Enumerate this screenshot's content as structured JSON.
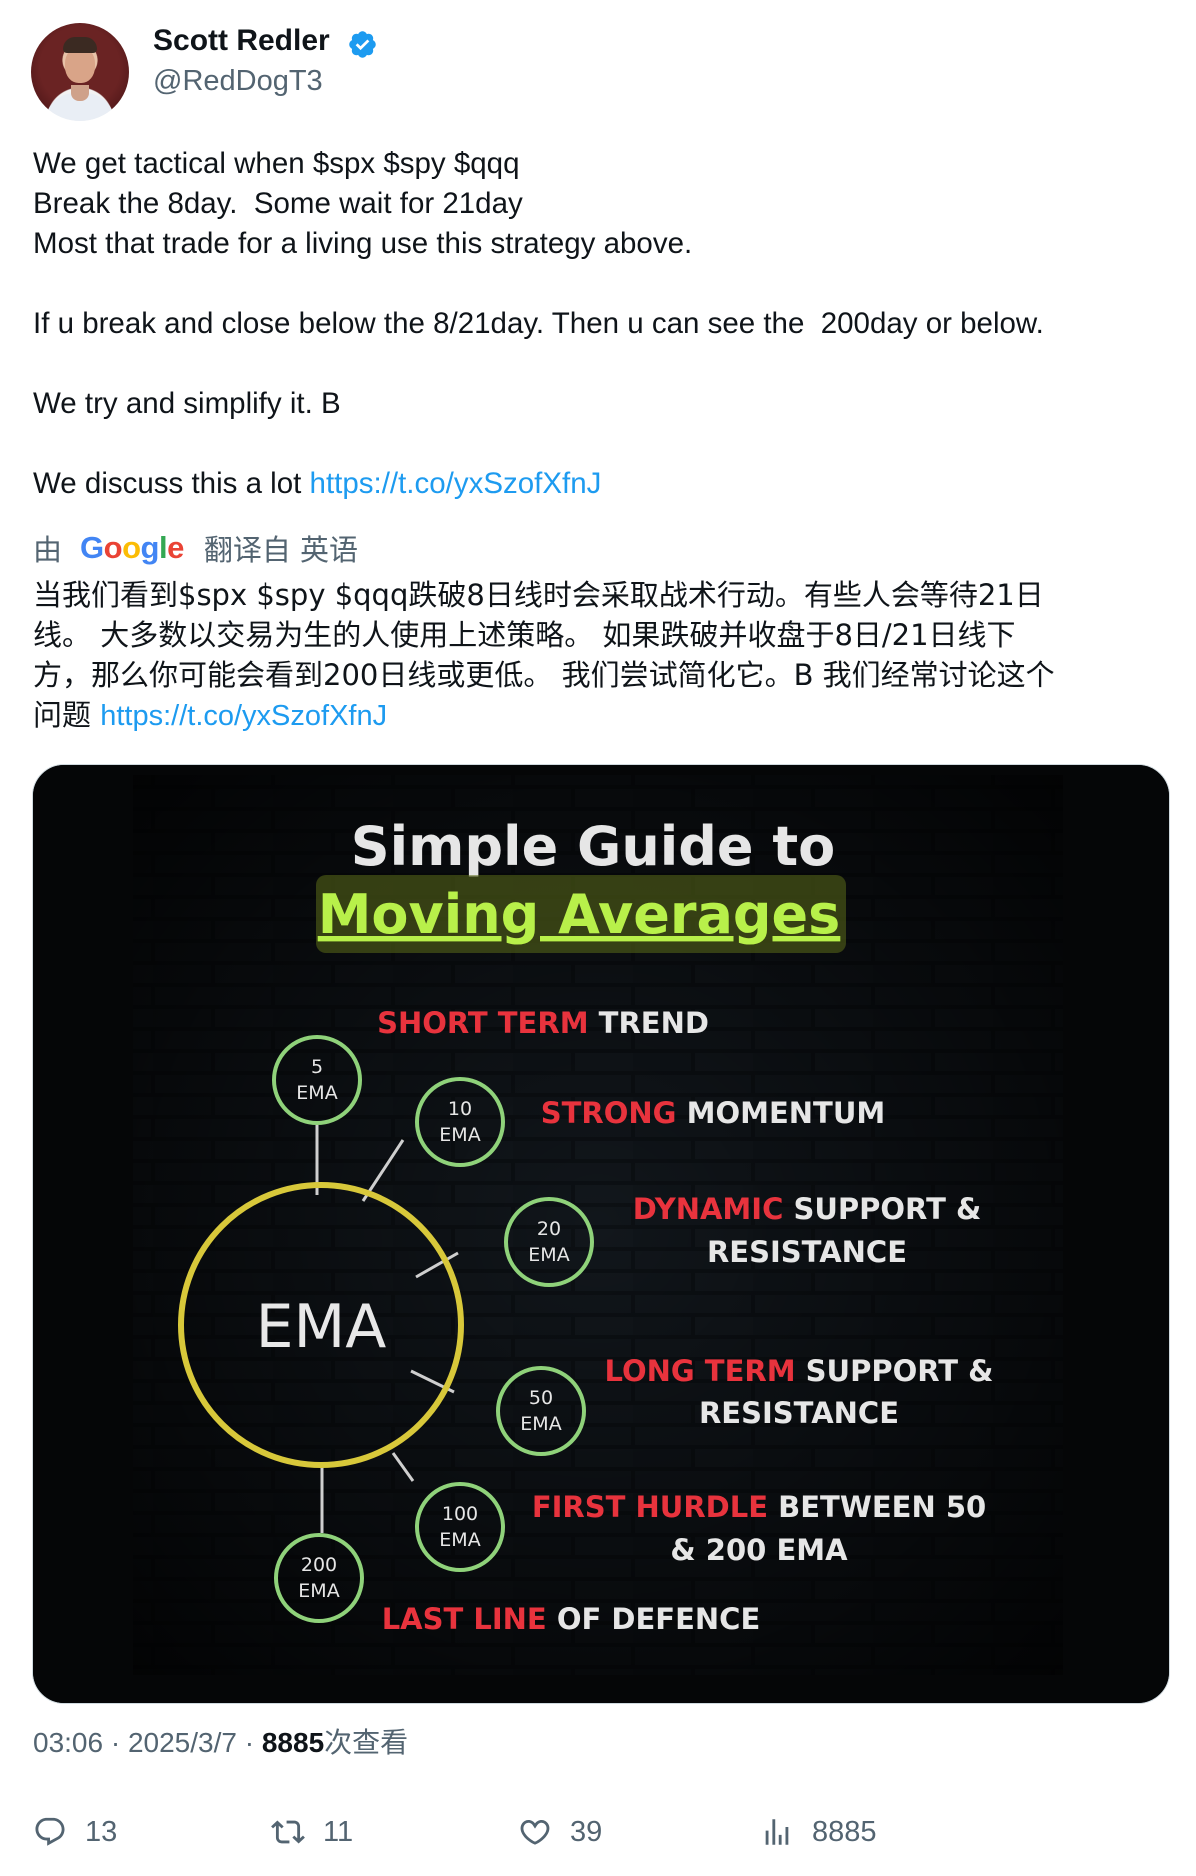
{
  "author": {
    "name": "Scott Redler",
    "handle": "@RedDogT3",
    "verified": true,
    "avatar_icon": "profile-photo"
  },
  "tweet": {
    "lines": [
      "We get tactical when $spx $spy $qqq",
      "Break the 8day.  Some wait for 21day",
      "Most that trade for a living use this strategy above.",
      "",
      "If u break and close below the 8/21day. Then u can see the  200day or below.",
      "",
      "We try and simplify it. B",
      ""
    ],
    "last_line_prefix": "We discuss this a lot ",
    "link": "https://t.co/yxSzofXfnJ"
  },
  "translation": {
    "by": "由",
    "google": [
      "G",
      "o",
      "o",
      "g",
      "l",
      "e"
    ],
    "from": "翻译自 英语",
    "lines": [
      "当我们看到$spx $spy $qqq跌破8日线时会采取战术行动。有些人会等待21日",
      "线。 大多数以交易为生的人使用上述策略。 如果跌破并收盘于8日/21日线下",
      "方，那么你可能会看到200日线或更低。 我们尝试简化它。B 我们经常讨论这个"
    ],
    "last_prefix": "问题 ",
    "link": "https://t.co/yxSzofXfnJ"
  },
  "media": {
    "title_line1": "Simple Guide to",
    "title_line2": "Moving Averages",
    "center_label": "EMA",
    "nodes": [
      {
        "num": "5",
        "unit": "EMA"
      },
      {
        "num": "10",
        "unit": "EMA"
      },
      {
        "num": "20",
        "unit": "EMA"
      },
      {
        "num": "50",
        "unit": "EMA"
      },
      {
        "num": "100",
        "unit": "EMA"
      },
      {
        "num": "200",
        "unit": "EMA"
      }
    ],
    "descriptions": [
      {
        "red": "SHORT TERM",
        "white": " TREND",
        "white2": ""
      },
      {
        "red": "STRONG",
        "white": " MOMENTUM",
        "white2": ""
      },
      {
        "red": "DYNAMIC",
        "white": " SUPPORT &",
        "white2": "RESISTANCE"
      },
      {
        "red": "LONG TERM",
        "white": " SUPPORT &",
        "white2": "RESISTANCE"
      },
      {
        "red": "FIRST HURDLE",
        "white": " BETWEEN 50",
        "white2": "& 200 EMA"
      },
      {
        "red": "LAST LINE",
        "white": " OF DEFENCE",
        "white2": ""
      }
    ],
    "colors": {
      "title_green": "#b8f04a",
      "accent_red": "#e8333d",
      "node_green": "#8fd27a",
      "ring_yellow": "#d8c83a"
    }
  },
  "meta": {
    "time": "03:06",
    "sep": " · ",
    "date": "2025/3/7",
    "views": "8885",
    "views_label": "次查看"
  },
  "actions": {
    "reply": "13",
    "retweet": "11",
    "like": "39",
    "views": "8885"
  }
}
